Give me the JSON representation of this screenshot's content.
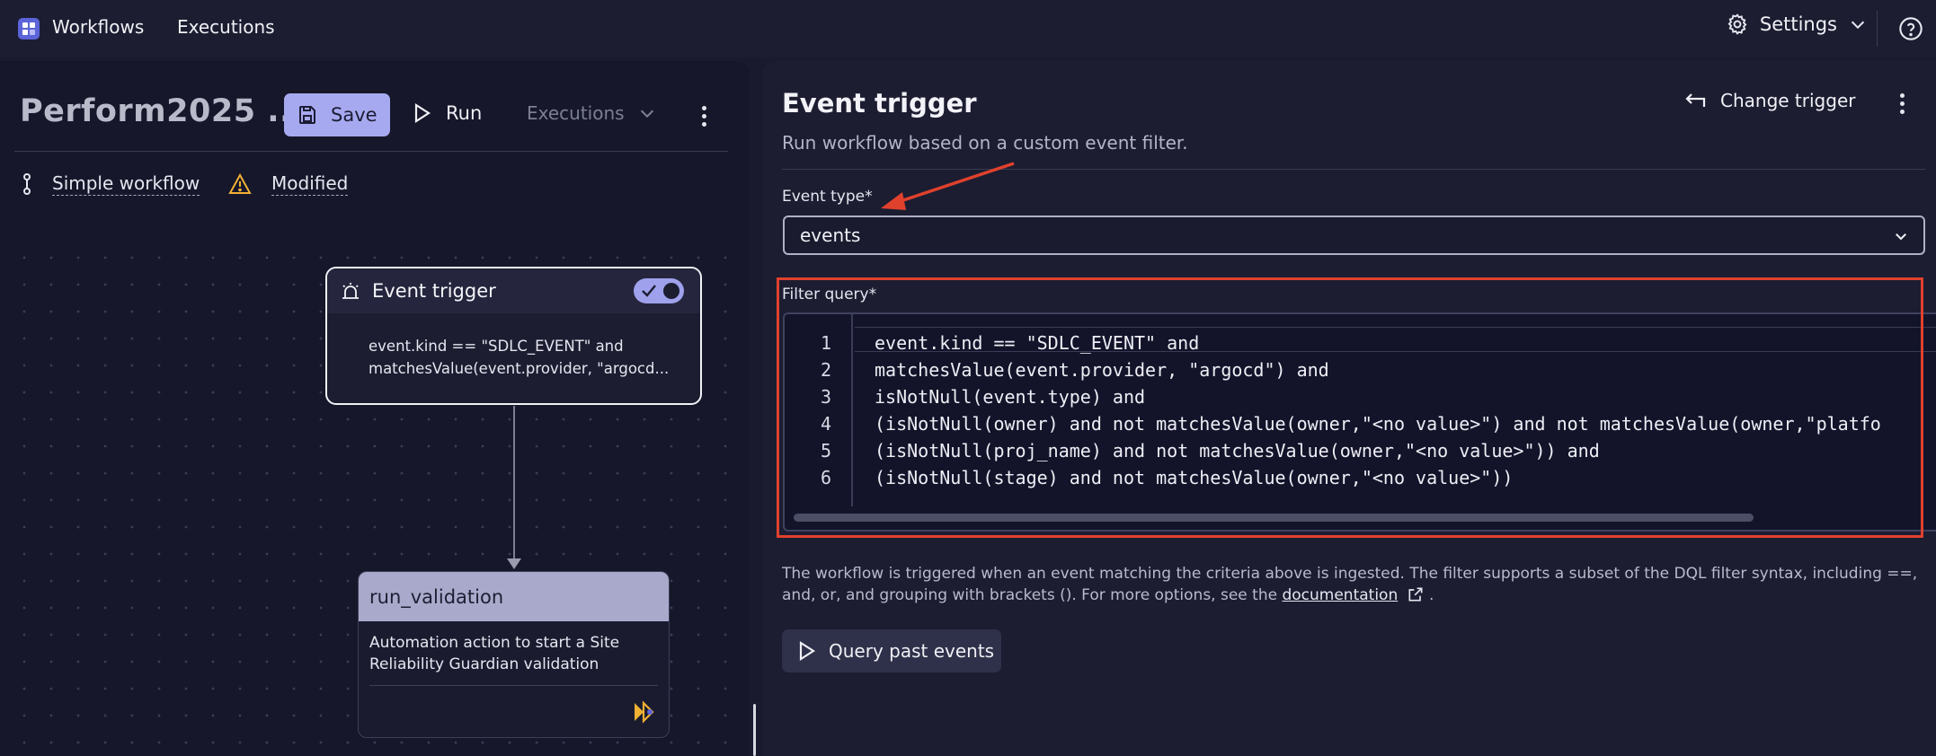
{
  "topbar": {
    "workflows": "Workflows",
    "executions": "Executions",
    "settings": "Settings"
  },
  "left": {
    "workflow_title": "Perform2025 ...",
    "save": "Save",
    "run": "Run",
    "executions": "Executions",
    "simple_workflow": "Simple workflow",
    "modified": "Modified",
    "trigger_node": {
      "title": "Event trigger",
      "line1": "event.kind == \"SDLC_EVENT\" and",
      "line2": "matchesValue(event.provider, \"argocd..."
    },
    "action_node": {
      "title": "run_validation",
      "line1": "Automation action to start a Site",
      "line2": "Reliability Guardian validation"
    }
  },
  "right": {
    "title": "Event trigger",
    "subtitle": "Run workflow based on a custom event filter.",
    "change_trigger": "Change trigger",
    "event_type_label": "Event type*",
    "event_type_value": "events",
    "filter_label": "Filter query*",
    "code": {
      "n1": "1",
      "n2": "2",
      "n3": "3",
      "n4": "4",
      "n5": "5",
      "n6": "6",
      "l1": "event.kind == \"SDLC_EVENT\" and",
      "l2": "matchesValue(event.provider, \"argocd\") and",
      "l3": "isNotNull(event.type) and",
      "l4": "(isNotNull(owner) and not matchesValue(owner,\"<no value>\") and not matchesValue(owner,\"platfo",
      "l5": "(isNotNull(proj_name) and not matchesValue(owner,\"<no value>\")) and",
      "l6": "(isNotNull(stage) and not matchesValue(owner,\"<no value>\"))"
    },
    "help_text_1": "The workflow is triggered when an event matching the criteria above is ingested. The filter supports a subset of the DQL filter syntax, including ==, and, or, and grouping with brackets (). For more options, see the",
    "doc_link": "documentation",
    "help_text_end": ".",
    "query_past_events": "Query past events"
  },
  "colors": {
    "accent": "#a7a9f0",
    "highlight_box": "#e0412d",
    "background": "#191a2e"
  }
}
